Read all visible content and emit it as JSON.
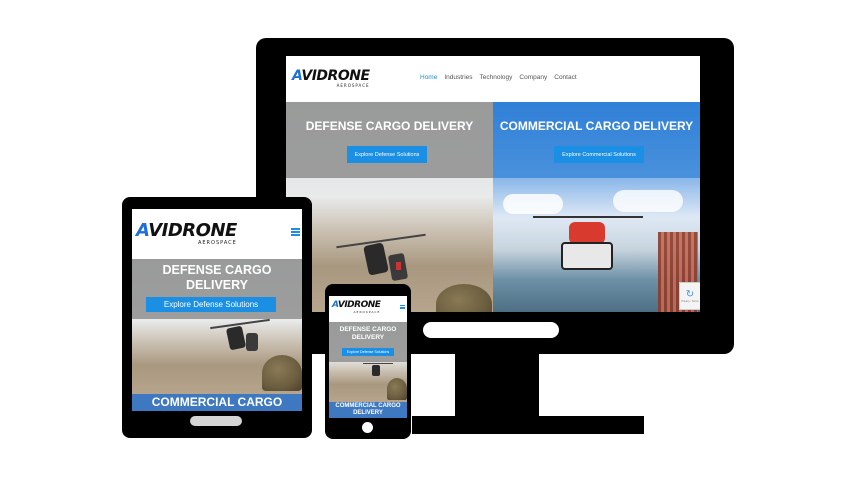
{
  "brand": {
    "logo_prefix": "A",
    "logo_rest": "VIDRONE",
    "logo_subtitle": "AEROSPACE"
  },
  "desktop": {
    "nav": [
      {
        "label": "Home",
        "active": true
      },
      {
        "label": "Industries",
        "active": false
      },
      {
        "label": "Technology",
        "active": false
      },
      {
        "label": "Company",
        "active": false
      },
      {
        "label": "Contact",
        "active": false
      }
    ],
    "left_hero": {
      "title": "DEFENSE CARGO DELIVERY",
      "button": "Explore Defense Solutions"
    },
    "right_hero": {
      "title": "COMMERCIAL CARGO DELIVERY",
      "button": "Explore Commercial Solutions"
    },
    "recaptcha_text": "Privacy - Terms"
  },
  "tablet": {
    "hero_title_line1": "DEFENSE CARGO",
    "hero_title_line2": "DELIVERY",
    "button": "Explore Defense Solutions",
    "next_section_title": "COMMERCIAL CARGO"
  },
  "phone": {
    "hero_title_line1": "DEFENSE CARGO",
    "hero_title_line2": "DELIVERY",
    "button": "Explore Defense Solutions",
    "next_section_title_line1": "COMMERCIAL CARGO",
    "next_section_title_line2": "DELIVERY"
  },
  "colors": {
    "accent": "#1a8fe3",
    "nav_active": "#1a8fe3",
    "device_frame": "#000000"
  }
}
